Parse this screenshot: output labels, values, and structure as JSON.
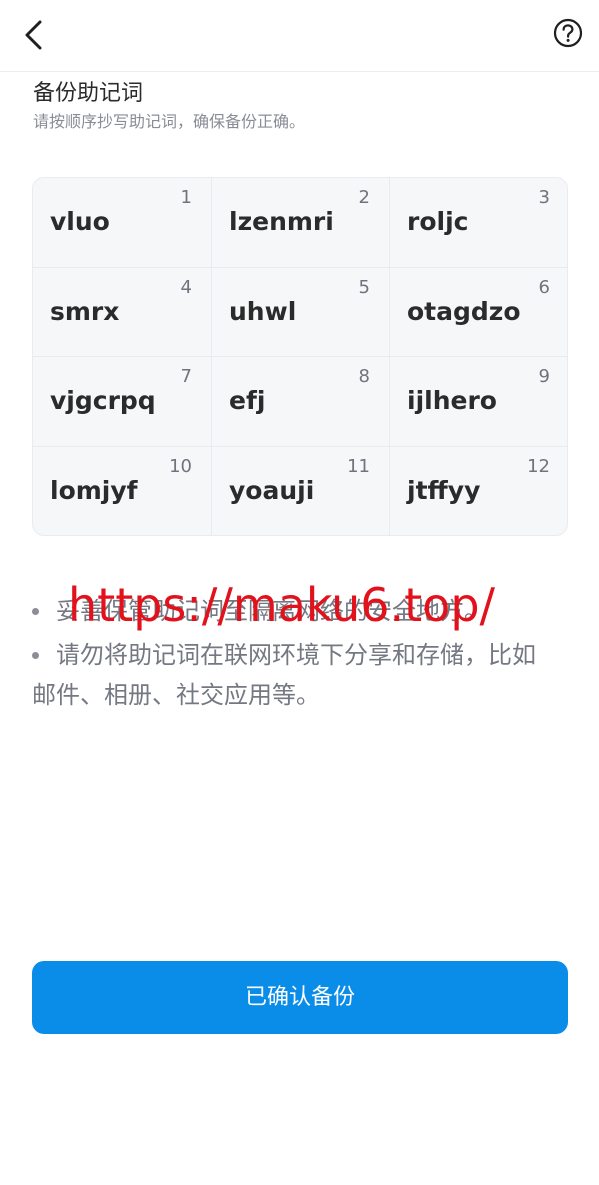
{
  "header": {
    "back_icon": "chevron-left-icon",
    "help_icon": "question-circle-icon"
  },
  "page": {
    "title": "备份助记词",
    "subtitle": "请按顺序抄写助记词，确保备份正确。"
  },
  "words": [
    {
      "index": "1",
      "word": "vluo"
    },
    {
      "index": "2",
      "word": "lzenmri"
    },
    {
      "index": "3",
      "word": "roljc"
    },
    {
      "index": "4",
      "word": "smrx"
    },
    {
      "index": "5",
      "word": "uhwl"
    },
    {
      "index": "6",
      "word": "otagdzo"
    },
    {
      "index": "7",
      "word": "vjgcrpq"
    },
    {
      "index": "8",
      "word": "efj"
    },
    {
      "index": "9",
      "word": "ijlhero"
    },
    {
      "index": "10",
      "word": "lomjyf"
    },
    {
      "index": "11",
      "word": "yoauji"
    },
    {
      "index": "12",
      "word": "jtffyy"
    }
  ],
  "tips": {
    "tip1": "妥善保管助记词至隔离网络的安全地方。",
    "tip2_line1": "请勿将助记词在联网环境下分享和存储，比如",
    "tip2_line2": "邮件、相册、社交应用等。"
  },
  "watermark": "https://maku6.top/",
  "confirm_button": "已确认备份",
  "colors": {
    "primary": "#0a8de9",
    "watermark": "#e2121c",
    "grid_bg": "#f6f7f9"
  }
}
